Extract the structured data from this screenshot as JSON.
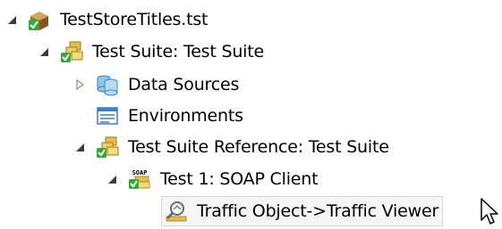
{
  "tree": {
    "nodes": [
      {
        "key": "root",
        "label": "TestStoreTitles.tst",
        "icon": "test-file-icon",
        "expanded": true
      },
      {
        "key": "suite",
        "label": "Test Suite: Test Suite",
        "icon": "test-suite-icon",
        "expanded": true
      },
      {
        "key": "datasources",
        "label": "Data Sources",
        "icon": "data-sources-icon",
        "expanded": false
      },
      {
        "key": "environments",
        "label": "Environments",
        "icon": "environments-icon"
      },
      {
        "key": "suiteref",
        "label": "Test Suite Reference: Test Suite",
        "icon": "test-suite-reference-icon",
        "expanded": true
      },
      {
        "key": "test1",
        "label": "Test 1: SOAP Client",
        "icon": "soap-client-icon",
        "expanded": true
      },
      {
        "key": "traffic",
        "label": "Traffic Object->Traffic Viewer",
        "icon": "traffic-viewer-icon",
        "selected": true
      }
    ]
  },
  "colors": {
    "expanded_arrow": "#3b3b3b",
    "collapsed_arrow": "#8c8c8c",
    "selection_background": "#f6f6f6",
    "selection_border": "#d8d8d8"
  }
}
